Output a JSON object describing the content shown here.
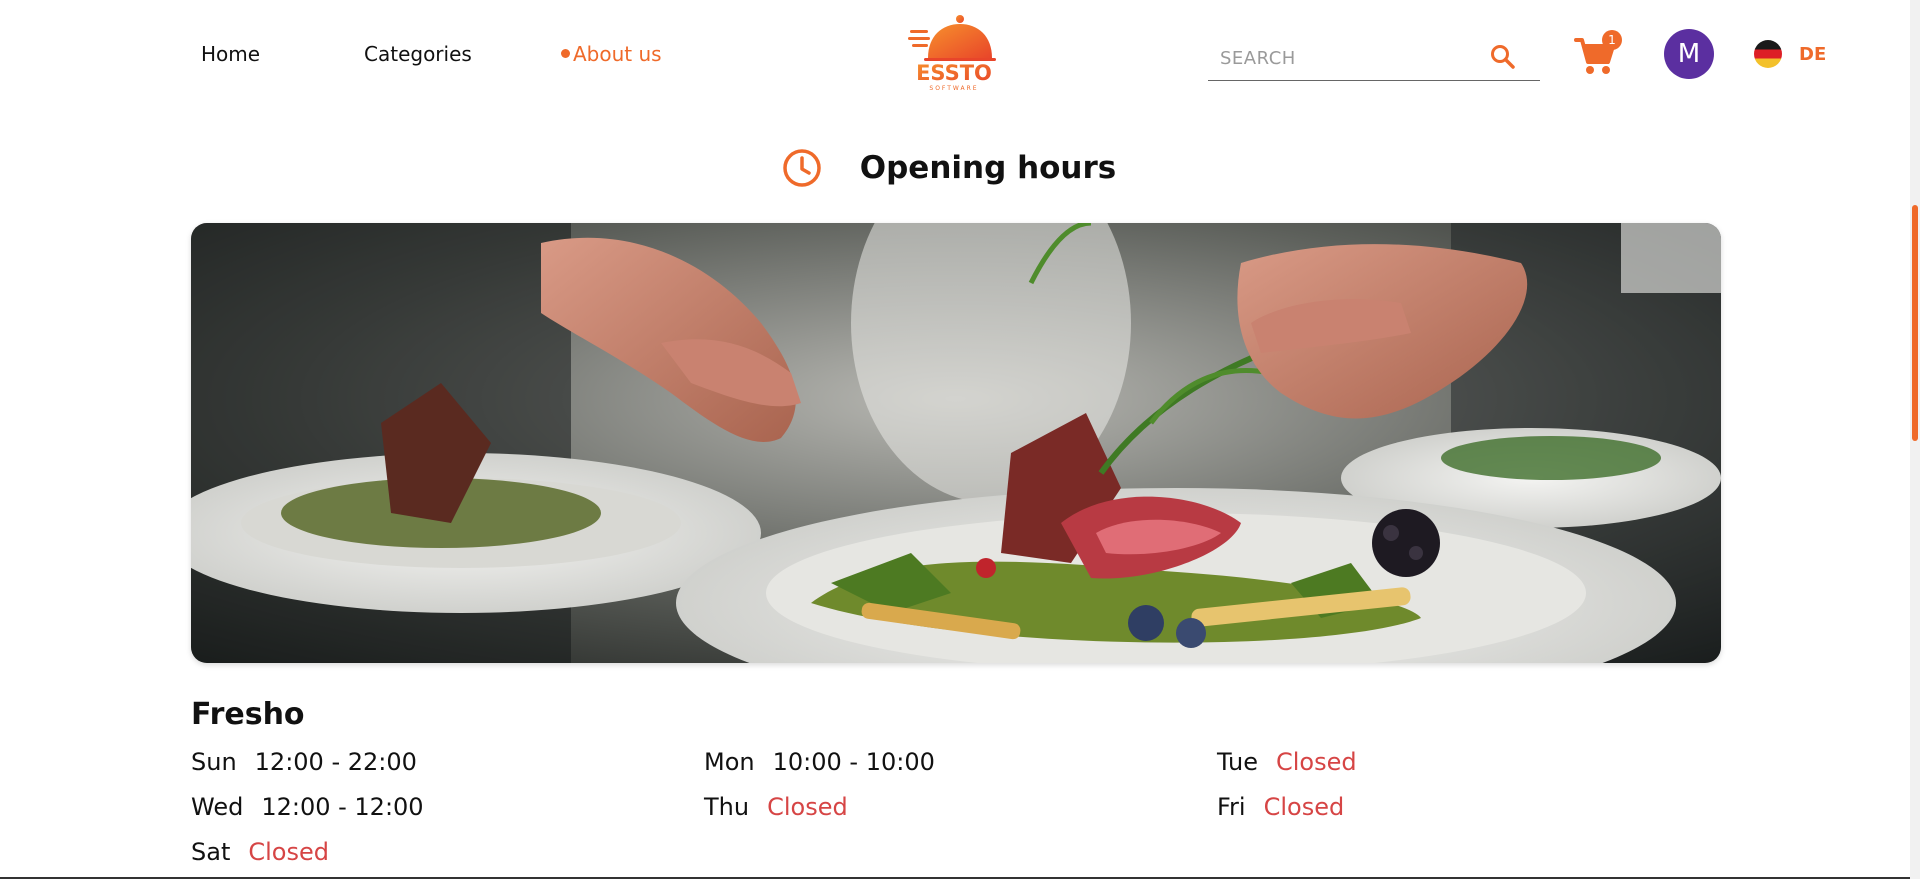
{
  "header": {
    "nav": [
      {
        "label": "Home"
      },
      {
        "label": "Categories"
      },
      {
        "label": "About us"
      }
    ],
    "logo": {
      "wordmark": "ESSTO",
      "subtitle": "SOFTWARE"
    },
    "search": {
      "placeholder": "SEARCH",
      "value": ""
    },
    "cart": {
      "count": "1"
    },
    "avatar": {
      "initial": "M"
    },
    "language": {
      "code": "DE"
    }
  },
  "section": {
    "title": "Opening hours"
  },
  "restaurant": {
    "name": "Fresho"
  },
  "hours": [
    {
      "day": "Sun",
      "time": "12:00 - 22:00",
      "closed": false
    },
    {
      "day": "Mon",
      "time": "10:00 - 10:00",
      "closed": false
    },
    {
      "day": "Tue",
      "time": "Closed",
      "closed": true
    },
    {
      "day": "Wed",
      "time": "12:00 - 12:00",
      "closed": false
    },
    {
      "day": "Thu",
      "time": "Closed",
      "closed": true
    },
    {
      "day": "Fri",
      "time": "Closed",
      "closed": true
    },
    {
      "day": "Sat",
      "time": "Closed",
      "closed": true
    }
  ],
  "icons": {
    "search": "search-icon",
    "cart": "cart-icon",
    "clock": "clock-icon",
    "flag": "germany-flag-icon",
    "logo": "cloche-logo-icon"
  },
  "colors": {
    "accent": "#ef6a2a",
    "closed": "#d64545",
    "avatar": "#5b2fa0"
  }
}
